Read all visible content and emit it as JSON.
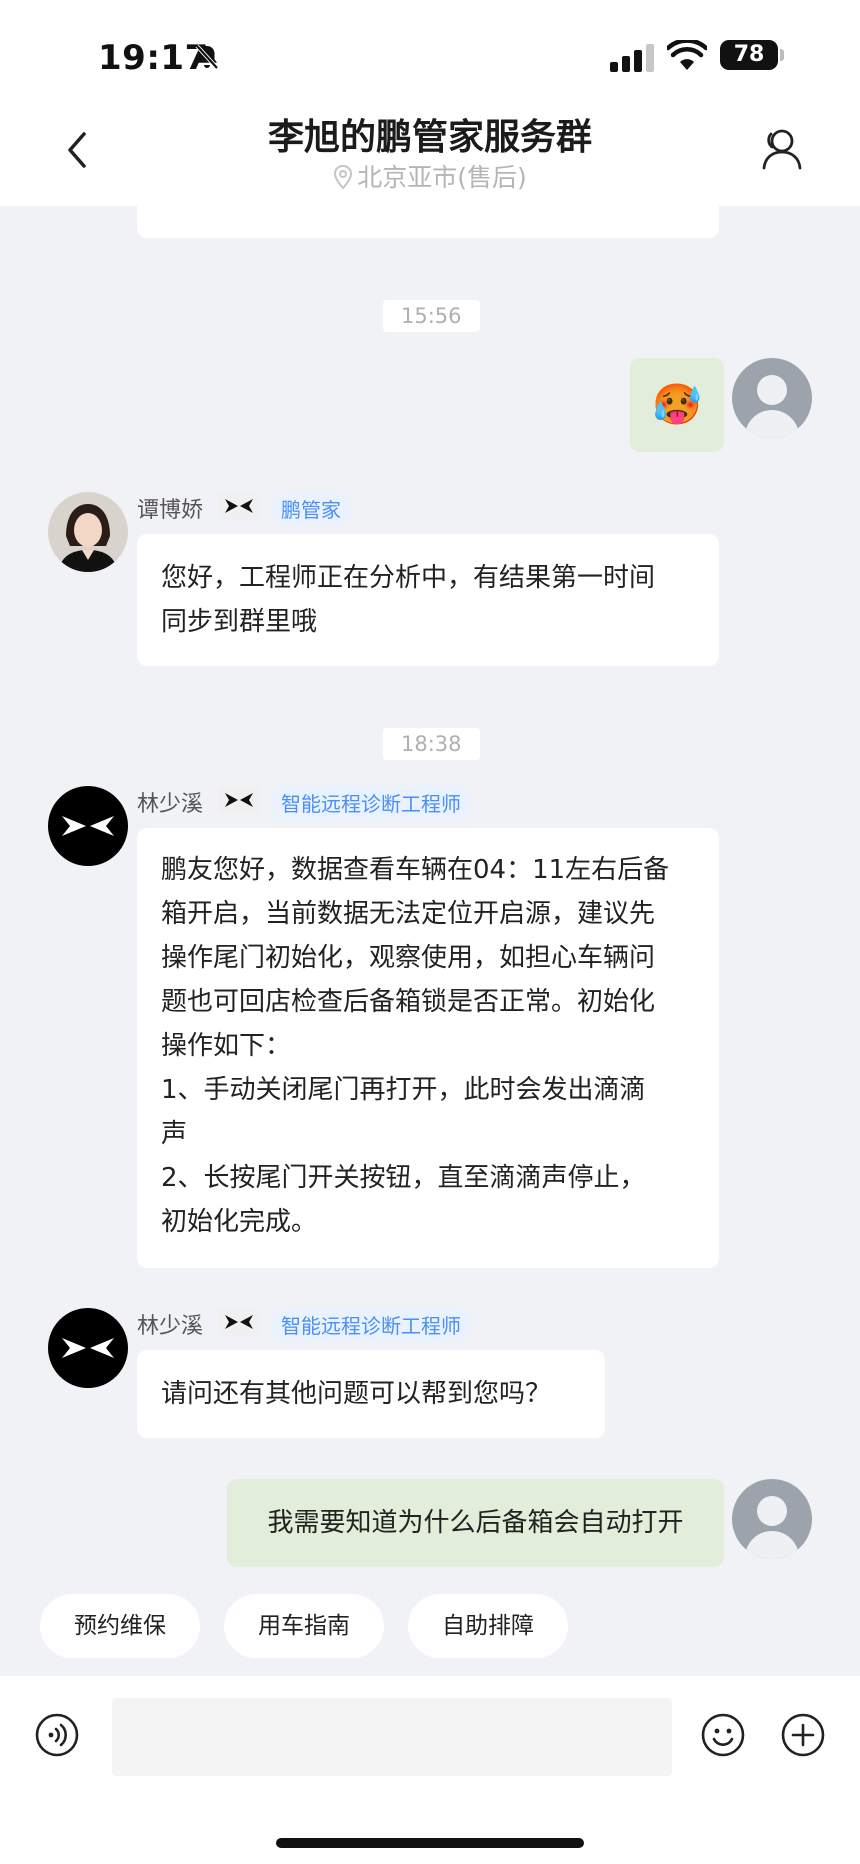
{
  "status": {
    "time": "19:17",
    "battery": "78"
  },
  "header": {
    "title": "李旭的鹏管家服务群",
    "subtitle": "北京亚市(售后)"
  },
  "chat": {
    "timestamps": [
      "15:56",
      "18:38"
    ],
    "emoji": "🥵",
    "messages": [
      {
        "sender": "谭博娇",
        "role": "鹏管家",
        "text": [
          "您好，工程师正在分析中，有结果第一时间",
          "同步到群里哦"
        ]
      },
      {
        "sender": "林少溪",
        "role": "智能远程诊断工程师",
        "text": [
          "鹏友您好，数据查看车辆在04：11左右后备",
          "箱开启，当前数据无法定位开启源，建议先",
          "操作尾门初始化，观察使用，如担心车辆问",
          "题也可回店检查后备箱锁是否正常。初始化",
          "操作如下：",
          "1、手动关闭尾门再打开，此时会发出滴滴",
          "声",
          "2、长按尾门开关按钮，直至滴滴声停止，",
          "初始化完成。"
        ]
      },
      {
        "sender": "林少溪",
        "role": "智能远程诊断工程师",
        "text": "请问还有其他问题可以帮到您吗？"
      }
    ],
    "my_message": "我需要知道为什么后备箱会自动打开"
  },
  "quick_replies": [
    "预约维保",
    "用车指南",
    "自助排障"
  ],
  "input": {
    "placeholder": ""
  }
}
